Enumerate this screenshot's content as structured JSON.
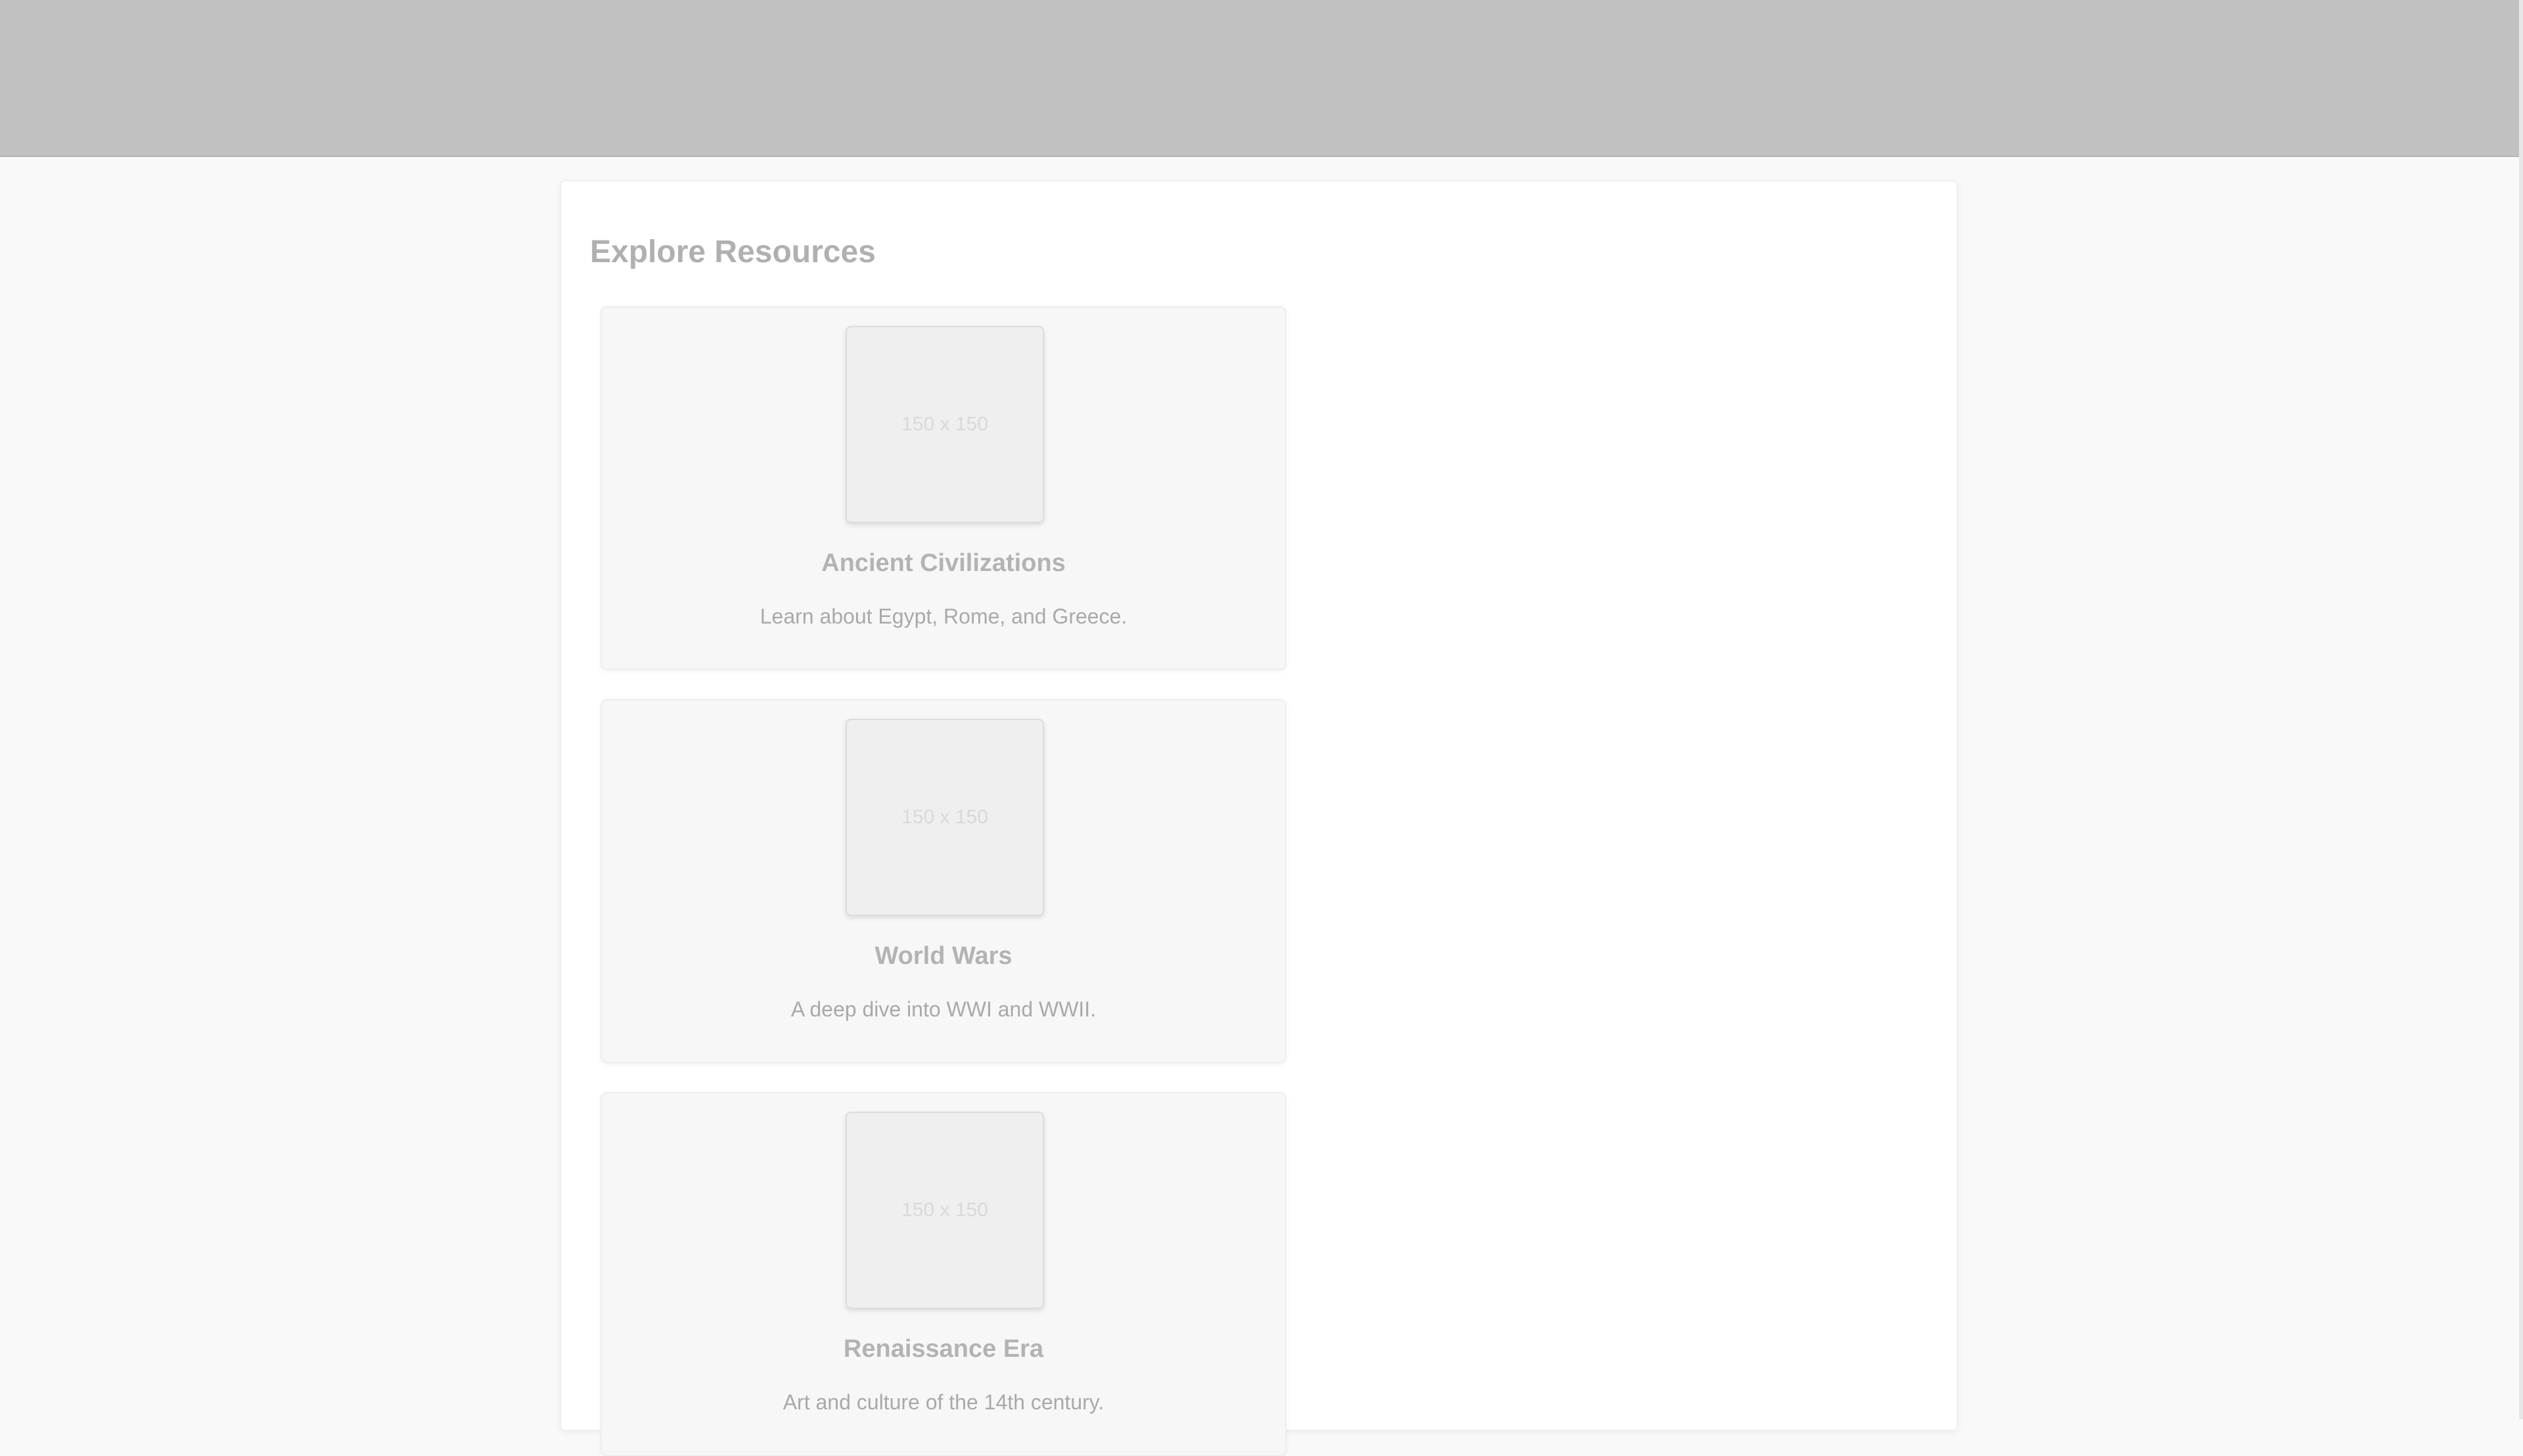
{
  "main": {
    "section_title": "Explore Resources",
    "cards": [
      {
        "image_label": "150 x 150",
        "title": "Ancient Civilizations",
        "description": "Learn about Egypt, Rome, and Greece."
      },
      {
        "image_label": "150 x 150",
        "title": "World Wars",
        "description": "A deep dive into WWI and WWII."
      },
      {
        "image_label": "150 x 150",
        "title": "Renaissance Era",
        "description": "Art and culture of the 14th century."
      }
    ]
  },
  "colors": {
    "header_background": "#c1c1c1",
    "page_background": "#f9f9f9",
    "panel_background": "#ffffff",
    "card_background": "#f7f7f7"
  },
  "icons": [
    "image-placeholder-icon"
  ]
}
